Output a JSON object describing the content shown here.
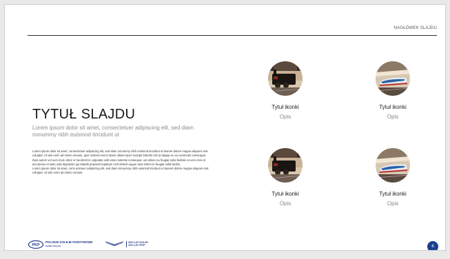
{
  "slide": {
    "header_label": "NAGŁÓWEK SLAJDU",
    "title": "TYTUŁ SLAJDU",
    "subtitle": "Lorem ipsum dolor sit amet, consectetuer adipiscing elit, sed diam nonummy nibh euismod tincidunt ut",
    "body": [
      "Lorem ipsum dolor sit amet, consectetuer adipiscing elit, sed diam nonummy nibh euismod tincidunt ut laoreet dolore magna aliquam erat volutpat. Ut wisi enim ad minim veniam, quis nostrud exerci tation ullamcorper suscipit lobortis nisl ut aliquip ex ea commodo consequat. Duis autem vel eum iriure dolor in hendrerit in vulputate velit esse molestie consequat, vel dolore eu feugiat nulla facilisis at vero eros et accumsan et iusto odio dignissim qui blandit praesent luptatum zzril delenit augue duis dolore te feugait nulla facilisi.",
      "Lorem ipsum dolor sit amet, cons ectetuer adipiscing elit, sed diam nonummy nibh euismod tincidunt ut laoreet dolore magna aliquam erat volutpat. Ut wisi enim ad minim veniam."
    ],
    "tiles": [
      {
        "title": "Tytuł ikonki",
        "subtitle": "Opis",
        "image": "steam-locomotive"
      },
      {
        "title": "Tytuł ikonki",
        "subtitle": "Opis",
        "image": "high-speed-train"
      },
      {
        "title": "Tytuł ikonki",
        "subtitle": "Opis",
        "image": "steam-locomotive"
      },
      {
        "title": "Tytuł ikonki",
        "subtitle": "Opis",
        "image": "high-speed-train"
      }
    ],
    "page_number": "6"
  },
  "footer": {
    "logo_badge": "PKP",
    "logo_name": "POLSKIE KOLEJE PAŃSTWOWE",
    "logo_tagline": "Spółka Akcyjna",
    "anniversary_line1": "200 LAT KOLEI",
    "anniversary_line2": "100 LAT PKP"
  },
  "colors": {
    "brand_blue": "#1c3f8f",
    "text_dark": "#1a1a1a",
    "text_muted": "#8a8a8a"
  }
}
